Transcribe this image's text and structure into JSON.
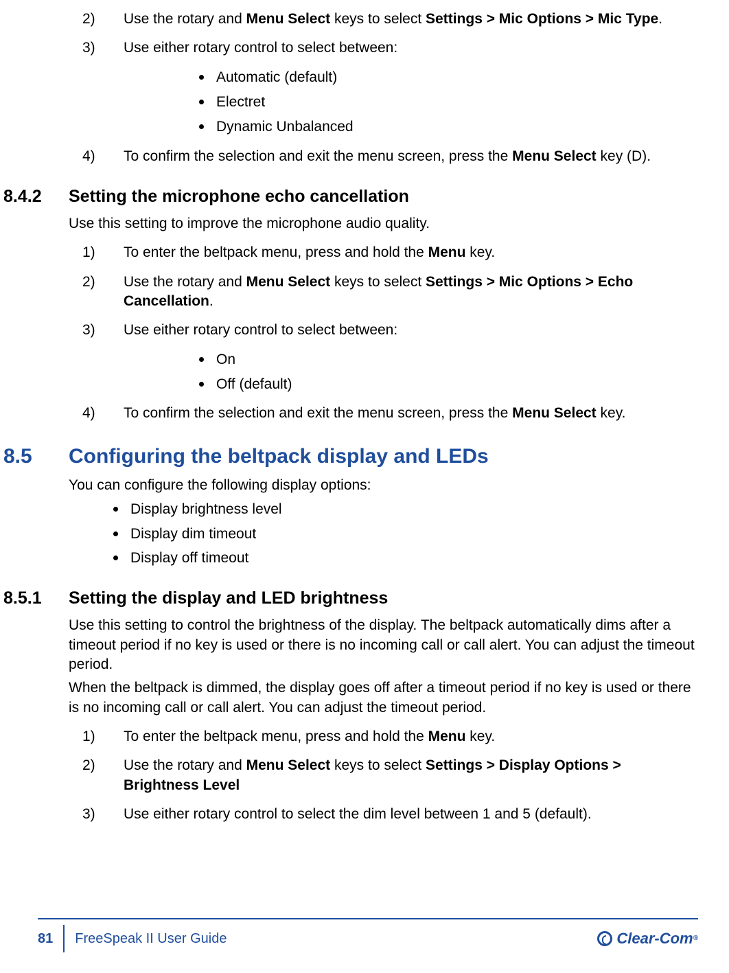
{
  "section_841": {
    "step2": {
      "num": "2)",
      "pre": "Use the rotary and ",
      "b1": "Menu Select",
      "mid": " keys to select ",
      "b2": "Settings > Mic Options > Mic Type",
      "post": "."
    },
    "step3": {
      "num": "3)",
      "text": "Use either rotary control to select between:"
    },
    "bullets3": [
      "Automatic (default)",
      "Electret",
      "Dynamic Unbalanced"
    ],
    "step4": {
      "num": "4)",
      "pre": "To confirm the selection and exit the menu screen, press the ",
      "b1": "Menu Select",
      "post": " key (D)."
    }
  },
  "section_842": {
    "num": "8.4.2",
    "title": "Setting the microphone echo cancellation",
    "intro": "Use this setting to improve the microphone audio quality.",
    "step1": {
      "num": "1)",
      "pre": "To enter the beltpack menu, press and hold the ",
      "b1": "Menu",
      "post": " key."
    },
    "step2": {
      "num": "2)",
      "pre": "Use the rotary and ",
      "b1": "Menu Select",
      "mid": " keys to select ",
      "b2": "Settings > Mic Options > Echo Cancellation",
      "post": "."
    },
    "step3": {
      "num": "3)",
      "text": "Use either rotary control to select between:"
    },
    "bullets3": [
      "On",
      "Off (default)"
    ],
    "step4": {
      "num": "4)",
      "pre": "To confirm the selection and exit the menu screen, press the ",
      "b1": "Menu Select",
      "post": " key."
    }
  },
  "section_85": {
    "num": "8.5",
    "title": "Configuring the beltpack display and LEDs",
    "intro": "You can configure the following display options:",
    "bullets": [
      "Display brightness level",
      "Display dim timeout",
      "Display off timeout"
    ]
  },
  "section_851": {
    "num": "8.5.1",
    "title": "Setting the display and LED brightness",
    "para1": "Use this setting to control the brightness of the display. The beltpack automatically dims after a timeout period if no key is used or there is no incoming call or call alert. You can adjust the timeout period.",
    "para2": "When the beltpack is dimmed, the display goes off after a timeout period if no key is used or there is no incoming call or call alert. You can adjust the timeout period.",
    "step1": {
      "num": "1)",
      "pre": "To enter the beltpack menu, press and hold the ",
      "b1": "Menu",
      "post": " key."
    },
    "step2": {
      "num": "2)",
      "pre": "Use the rotary and ",
      "b1": "Menu Select",
      "mid": " keys to select ",
      "b2": "Settings > Display Options > Brightness Level",
      "post": ""
    },
    "step3": {
      "num": "3)",
      "text": "Use either rotary control to select the dim level between 1 and 5 (default)."
    }
  },
  "footer": {
    "page": "81",
    "title": "FreeSpeak II User Guide",
    "brand": "Clear-Com"
  }
}
